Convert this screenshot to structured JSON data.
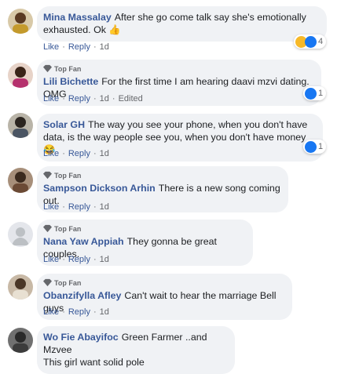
{
  "comments": [
    {
      "author": "Mina Massalay",
      "text": "After she go come talk say she's emotionally exhausted. Ok 👍",
      "like_label": "Like",
      "reply_label": "Reply",
      "time": "1d",
      "reaction_count": "4",
      "reaction_icons": [
        "haha-icon",
        "like-icon"
      ]
    },
    {
      "badge": "Top Fan",
      "author": "Lili Bichette",
      "text": "For the first time I am hearing daavi mzvi dating. OMG",
      "like_label": "Like",
      "reply_label": "Reply",
      "time": "1d",
      "edited": "Edited",
      "reaction_count": "1",
      "reaction_icons": [
        "like-icon"
      ]
    },
    {
      "author": "Solar GH",
      "text": "The way you see your phone, when you don't have data, is the way people see you, when you don't have money😂",
      "like_label": "Like",
      "reply_label": "Reply",
      "time": "1d",
      "reaction_count": "1",
      "reaction_icons": [
        "like-icon"
      ]
    },
    {
      "badge": "Top Fan",
      "author": "Sampson Dickson Arhin",
      "text": "There is a new song coming out.",
      "like_label": "Like",
      "reply_label": "Reply",
      "time": "1d"
    },
    {
      "badge": "Top Fan",
      "author": "Nana Yaw Appiah",
      "text": "They gonna be great couples.",
      "like_label": "Like",
      "reply_label": "Reply",
      "time": "1d"
    },
    {
      "badge": "Top Fan",
      "author": "Obanzifylla Afley",
      "text": "Can't wait to hear the marriage Bell guys",
      "like_label": "Like",
      "reply_label": "Reply",
      "time": "1d"
    },
    {
      "author": "Wo Fie Abayifoc",
      "text": "Green Farmer ..and Mzvee",
      "text2": "This girl want solid pole"
    }
  ],
  "separator": "·",
  "colors": {
    "link": "#385898",
    "bubble": "#f0f2f5",
    "like_blue": "#1877f2",
    "haha_yellow": "#f7b928"
  }
}
